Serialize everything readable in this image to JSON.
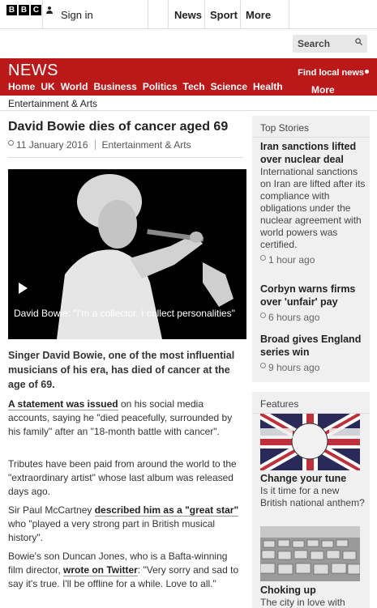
{
  "header": {
    "logo": [
      "B",
      "B",
      "C"
    ],
    "sign_in": "Sign in",
    "nav": [
      "News",
      "Sport",
      "More"
    ],
    "search_placeholder": "Search"
  },
  "news_band": {
    "brand": "NEWS",
    "find_local": "Find local news",
    "sections": [
      "Home",
      "UK",
      "World",
      "Business",
      "Politics",
      "Tech",
      "Science",
      "Health"
    ],
    "more": "More",
    "color": "#bb1919"
  },
  "breadcrumb": "Entertainment & Arts",
  "article": {
    "headline": "David Bowie dies of cancer aged 69",
    "date": "11 January 2016",
    "section": "Entertainment & Arts",
    "image_caption": "David Bowie: \"I'm a collector. I collect personalities\"",
    "lead": "Singer David Bowie, one of the most influential musicians of his era, has died of cancer at the age of 69.",
    "p2_link": "A statement was issued",
    "p2_rest": " on his social media accounts, saying he \"died peacefully, surrounded by his family\" after an \"18-month battle with cancer\".",
    "p3": "Tributes have been paid from around the world to the \"extraordinary artist\" whose last album was released days ago.",
    "p4_pre": "Sir Paul McCartney ",
    "p4_link": "described him as a \"great star\"",
    "p4_post": " who \"played a very strong part in British musical history\".",
    "p5_pre": "Bowie's son Duncan Jones, who is a Bafta-winning film director, ",
    "p5_link": "wrote on Twitter",
    "p5_post": ": \"Very sorry and sad to say it's true. I'll be offline for a while. Love to all.\""
  },
  "top_stories": {
    "heading": "Top Stories",
    "items": [
      {
        "title": "Iran sanctions lifted over nuclear deal",
        "summary": "International sanctions on Iran are lifted after its compliance with obligations under the nuclear agreement with world powers was certified.",
        "time": "1 hour ago"
      },
      {
        "title": "Corbyn warns firms over 'unfair' pay",
        "summary": "",
        "time": "6 hours ago"
      },
      {
        "title": "Broad gives England series win",
        "summary": "",
        "time": "9 hours ago"
      }
    ]
  },
  "features": {
    "heading": "Features",
    "items": [
      {
        "title": "Change your tune",
        "summary": "Is it time for a new British national anthem?"
      },
      {
        "title": "Choking up",
        "summary": "The city in love with"
      }
    ]
  }
}
